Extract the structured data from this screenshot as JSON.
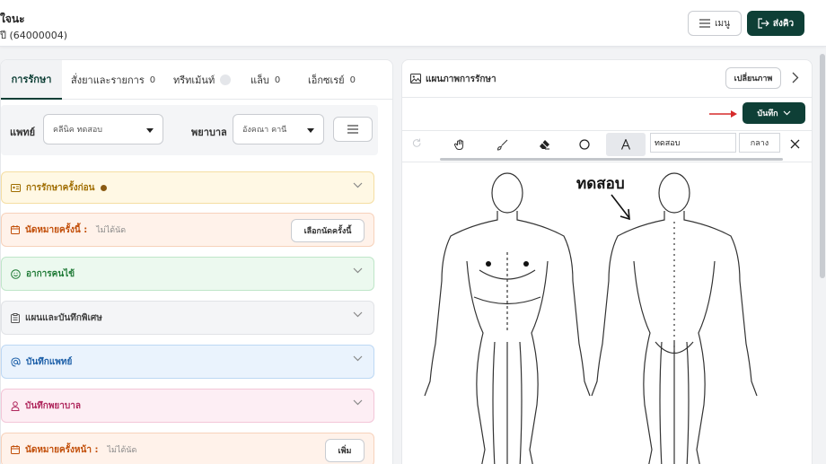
{
  "header": {
    "patient_name": "ใจนะ",
    "patient_sub": "ปี (64000004)",
    "menu_label": "เมนู",
    "queue_label": "ส่งคิว"
  },
  "tabs": [
    {
      "label": "การรักษา",
      "count": ""
    },
    {
      "label": "สั่งยาและรายการ",
      "count": "0"
    },
    {
      "label": "ทรีทเม้นท์",
      "count": ""
    },
    {
      "label": "แล็บ",
      "count": "0"
    },
    {
      "label": "เอ็กซเรย์",
      "count": "0"
    }
  ],
  "staff": {
    "doctor_label": "แพทย์",
    "doctor_value": "คลีนิค ทดสอบ",
    "nurse_label": "พยาบาล",
    "nurse_value": "อังคณา คานี"
  },
  "cards": {
    "previous": {
      "label": "การรักษาครั้งก่อน"
    },
    "appt_today": {
      "label": "นัดหมายครั้งนี้ :",
      "sub": "ไม่ได้นัด",
      "button": "เลือกนัดครั้งนี้"
    },
    "symptoms": {
      "label": "อาการคนไข้"
    },
    "plan": {
      "label": "แผนและบันทึกพิเศษ"
    },
    "doctor_note": {
      "label": "บันทึกแพทย์"
    },
    "nurse_note": {
      "label": "บันทึกพยาบาล"
    },
    "appt_next": {
      "label": "นัดหมายครั้งหน้า :",
      "sub": "ไม่ได้นัด",
      "button": "เพิ่ม"
    }
  },
  "right": {
    "title": "แผนภาพการรักษา",
    "change_label": "เปลี่ยนภาพ",
    "save_label": "บันทึก",
    "text_value": "ทดสอบ",
    "size_value": "กลาง",
    "annotation": "ทดสอบ"
  },
  "colors": {
    "primary": "#0e3f36",
    "arrow_red": "#d62b2b"
  }
}
